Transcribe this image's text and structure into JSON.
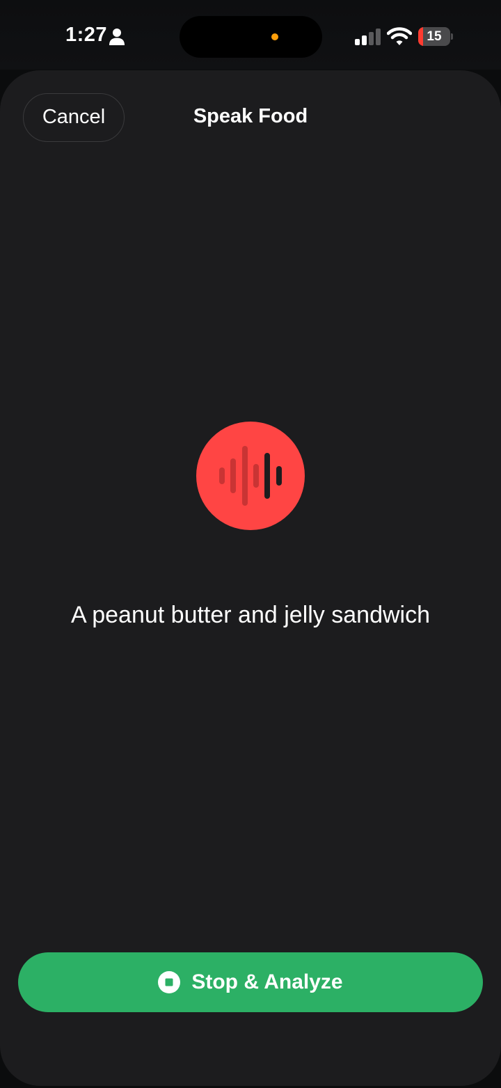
{
  "status_bar": {
    "time": "1:27",
    "battery_level": 15,
    "battery_label": "15",
    "icons": [
      "person-icon",
      "cellular-signal-icon",
      "wifi-icon",
      "battery-icon"
    ],
    "colors": {
      "privacy_dot": "#ff9f0a",
      "battery_low": "#ff3b30"
    }
  },
  "header": {
    "cancel_label": "Cancel",
    "title": "Speak Food"
  },
  "recorder": {
    "icon": "waveform-icon",
    "accent_color": "#ff4544",
    "transcript": "A peanut butter and jelly sandwich"
  },
  "footer": {
    "stop_icon": "stop-icon",
    "stop_label": "Stop & Analyze",
    "button_color": "#2cb065"
  }
}
